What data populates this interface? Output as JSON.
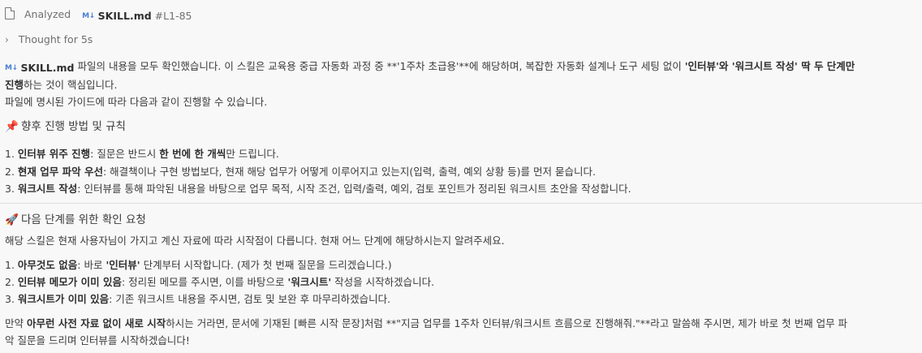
{
  "header": {
    "analyzed_label": "Analyzed",
    "file_badge": "M↓",
    "file_name": "SKILL.md",
    "line_range": "#L1-85"
  },
  "thought": {
    "label": "Thought for 5s"
  },
  "intro": {
    "file_badge": "M↓",
    "file_name": "SKILL.md",
    "p1_a": "파일의 내용을 모두 확인했습니다. 이 스킬은 교육용 중급 자동화 과정 중 **'1주차 초급용'**에 해당하며, 복잡한 자동화 설계나 도구 세팅 없이 ",
    "p1_b": "'인터뷰'와 '워크시트 작성' 딱 두 단계만",
    "p1_c": "진행",
    "p1_d": "하는 것이 핵심입니다.",
    "p2": "파일에 명시된 가이드에 따라 다음과 같이 진행할 수 있습니다."
  },
  "section1": {
    "icon": "pushpin-icon",
    "emoji": "📌",
    "title": "향후 진행 방법 및 규칙",
    "items": [
      {
        "num": "1.",
        "bold": "인터뷰 위주 진행",
        "text_a": ": 질문은 반드시 ",
        "bold2": "한 번에 한 개씩",
        "text_b": "만 드립니다."
      },
      {
        "num": "2.",
        "bold": "현재 업무 파악 우선",
        "text_a": ": 해결책이나 구현 방법보다, 현재 해당 업무가 어떻게 이루어지고 있는지(입력, 출력, 예외 상황 등)를 먼저 묻습니다.",
        "bold2": "",
        "text_b": ""
      },
      {
        "num": "3.",
        "bold": "워크시트 작성",
        "text_a": ": 인터뷰를 통해 파악된 내용을 바탕으로 업무 목적, 시작 조건, 입력/출력, 예외, 검토 포인트가 정리된 워크시트 초안을 작성합니다.",
        "bold2": "",
        "text_b": ""
      }
    ]
  },
  "section2": {
    "icon": "rocket-icon",
    "emoji": "🚀",
    "title": "다음 단계를 위한 확인 요청",
    "lead": "해당 스킬은 현재 사용자님이 가지고 계신 자료에 따라 시작점이 다릅니다. 현재 어느 단계에 해당하시는지 알려주세요.",
    "items": [
      {
        "num": "1.",
        "bold": "아무것도 없음",
        "text_a": ": 바로 ",
        "bold2": "'인터뷰'",
        "text_b": " 단계부터 시작합니다. (제가 첫 번째 질문을 드리겠습니다.)"
      },
      {
        "num": "2.",
        "bold": "인터뷰 메모가 이미 있음",
        "text_a": ": 정리된 메모를 주시면, 이를 바탕으로 ",
        "bold2": "'워크시트'",
        "text_b": " 작성을 시작하겠습니다."
      },
      {
        "num": "3.",
        "bold": "워크시트가 이미 있음",
        "text_a": ": 기존 워크시트 내용을 주시면, 검토 및 보완 후 마무리하겠습니다.",
        "bold2": "",
        "text_b": ""
      }
    ],
    "closing_a": "만약 ",
    "closing_bold": "아무런 사전 자료 없이 새로 시작",
    "closing_b": "하시는 거라면, 문서에 기재된 [빠른 시작 문장]처럼 **\"지금 업무를 1주차 인터뷰/워크시트 흐름으로 진행해줘.\"**라고 말씀해 주시면, 제가 바로 첫 번째 업무 파",
    "closing_c": "악 질문을 드리며 인터뷰를 시작하겠습니다!"
  }
}
